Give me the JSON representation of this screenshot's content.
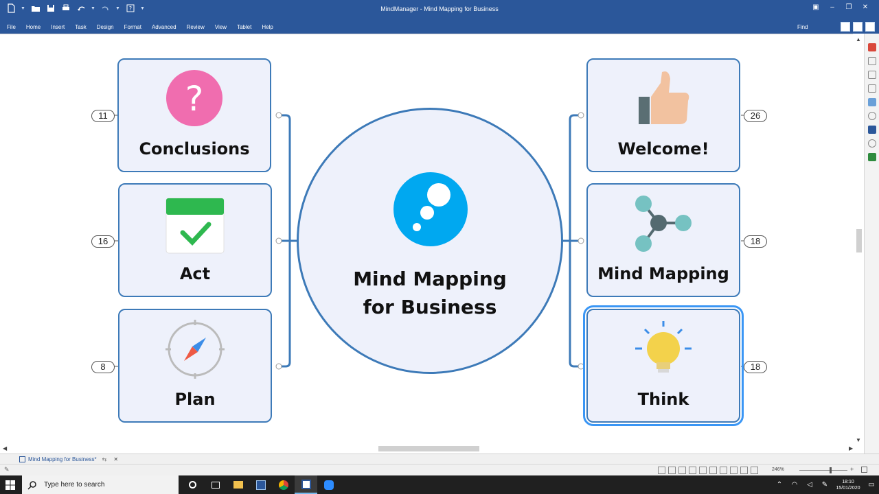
{
  "app": {
    "title": "MindManager - Mind Mapping for Business",
    "ribbon_tabs": [
      "File",
      "Home",
      "Insert",
      "Task",
      "Design",
      "Format",
      "Advanced",
      "Review",
      "View",
      "Tablet",
      "Help"
    ],
    "find_label": "Find"
  },
  "map": {
    "central_topic": {
      "line1": "Mind Mapping",
      "line2": "for Business",
      "icon": "mindmanager-bubbles-icon"
    },
    "left_topics": [
      {
        "label": "Conclusions",
        "count": "11",
        "icon": "question-mark-icon"
      },
      {
        "label": "Act",
        "count": "16",
        "icon": "calendar-check-icon"
      },
      {
        "label": "Plan",
        "count": "8",
        "icon": "compass-icon"
      }
    ],
    "right_topics": [
      {
        "label": "Welcome!",
        "count": "26",
        "icon": "thumbs-up-icon"
      },
      {
        "label": "Mind Mapping",
        "count": "18",
        "icon": "network-nodes-icon"
      },
      {
        "label": "Think",
        "count": "18",
        "icon": "light-bulb-icon",
        "selected": true
      }
    ],
    "colors": {
      "topic_border": "#3d7ab8",
      "topic_fill": "#eef1fb",
      "selection": "#3a96f5",
      "accent_blue": "#00a8f0"
    }
  },
  "document_tab": {
    "label": "Mind Mapping for Business*"
  },
  "statusbar": {
    "zoom": "246%"
  },
  "taskbar": {
    "search_placeholder": "Type here to search",
    "time": "18:10",
    "date": "15/01/2020"
  }
}
